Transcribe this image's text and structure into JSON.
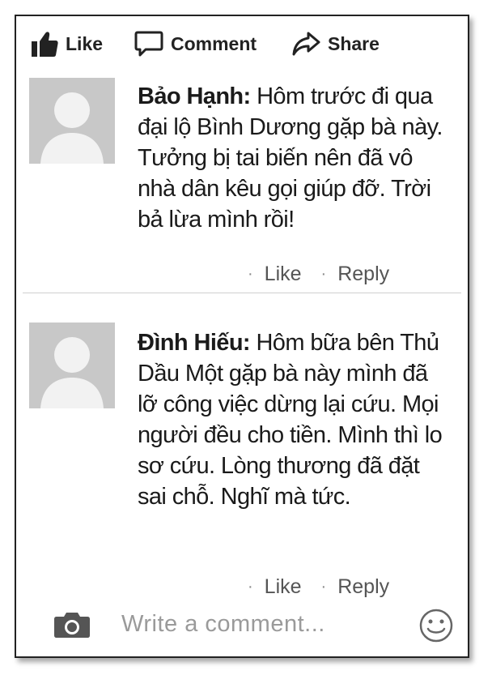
{
  "actions": {
    "like_label": "Like",
    "comment_label": "Comment",
    "share_label": "Share"
  },
  "comments": [
    {
      "author": "Bảo Hạnh:",
      "text": " Hôm trước đi qua đại lộ Bình Dương gặp bà này. Tưởng bị tai biến nên đã vô nhà dân kêu gọi giúp đỡ. Trời bả lừa mình rồi!",
      "like_label": "Like",
      "reply_label": "Reply",
      "separator": "·"
    },
    {
      "author": "Đình Hiếu:",
      "text": " Hôm bữa bên Thủ Dầu Một gặp bà này mình đã lỡ công việc dừng lại cứu. Mọi người đều cho tiền. Mình thì lo sơ cứu. Lòng thương đã đặt sai chỗ. Nghĩ mà tức.",
      "like_label": "Like",
      "reply_label": "Reply",
      "separator": "·"
    }
  ],
  "composer": {
    "placeholder": "Write a comment..."
  },
  "icons": {
    "like": "thumbs-up-icon",
    "comment": "speech-bubble-icon",
    "share": "share-arrow-icon",
    "camera": "camera-icon",
    "emoji": "smiley-icon",
    "avatar": "default-avatar-silhouette"
  }
}
